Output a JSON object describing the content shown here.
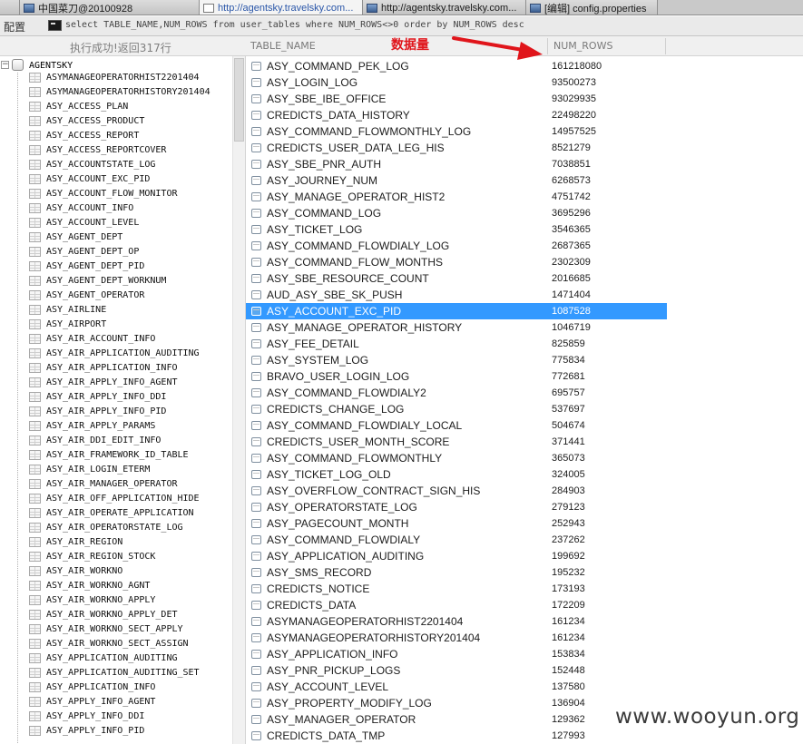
{
  "tabs": [
    {
      "title": "中国菜刀@20100928",
      "icon": "app-icon",
      "active": false
    },
    {
      "title": "http://agentsky.travelsky.com...",
      "icon": "page-icon",
      "active": true
    },
    {
      "title": "http://agentsky.travelsky.com...",
      "icon": "app-icon",
      "active": false
    },
    {
      "title": "[编辑] config.properties",
      "icon": "app-icon",
      "active": false
    }
  ],
  "toolbar": {
    "config_label": "配置",
    "sql": "select TABLE_NAME,NUM_ROWS from user_tables where NUM_ROWS<>0 order by NUM_ROWS desc"
  },
  "status": "执行成功!返回317行",
  "columns": {
    "table_name": "TABLE_NAME",
    "num_rows": "NUM_ROWS"
  },
  "annotation": {
    "label": "数据量",
    "color": "#e0151b"
  },
  "tree": {
    "root": "AGENTSKY",
    "items": [
      "ASYMANAGEOPERATORHIST2201404",
      "ASYMANAGEOPERATORHISTORY201404",
      "ASY_ACCESS_PLAN",
      "ASY_ACCESS_PRODUCT",
      "ASY_ACCESS_REPORT",
      "ASY_ACCESS_REPORTCOVER",
      "ASY_ACCOUNTSTATE_LOG",
      "ASY_ACCOUNT_EXC_PID",
      "ASY_ACCOUNT_FLOW_MONITOR",
      "ASY_ACCOUNT_INFO",
      "ASY_ACCOUNT_LEVEL",
      "ASY_AGENT_DEPT",
      "ASY_AGENT_DEPT_OP",
      "ASY_AGENT_DEPT_PID",
      "ASY_AGENT_DEPT_WORKNUM",
      "ASY_AGENT_OPERATOR",
      "ASY_AIRLINE",
      "ASY_AIRPORT",
      "ASY_AIR_ACCOUNT_INFO",
      "ASY_AIR_APPLICATION_AUDITING",
      "ASY_AIR_APPLICATION_INFO",
      "ASY_AIR_APPLY_INFO_AGENT",
      "ASY_AIR_APPLY_INFO_DDI",
      "ASY_AIR_APPLY_INFO_PID",
      "ASY_AIR_APPLY_PARAMS",
      "ASY_AIR_DDI_EDIT_INFO",
      "ASY_AIR_FRAMEWORK_ID_TABLE",
      "ASY_AIR_LOGIN_ETERM",
      "ASY_AIR_MANAGER_OPERATOR",
      "ASY_AIR_OFF_APPLICATION_HIDE",
      "ASY_AIR_OPERATE_APPLICATION",
      "ASY_AIR_OPERATORSTATE_LOG",
      "ASY_AIR_REGION",
      "ASY_AIR_REGION_STOCK",
      "ASY_AIR_WORKNO",
      "ASY_AIR_WORKNO_AGNT",
      "ASY_AIR_WORKNO_APPLY",
      "ASY_AIR_WORKNO_APPLY_DET",
      "ASY_AIR_WORKNO_SECT_APPLY",
      "ASY_AIR_WORKNO_SECT_ASSIGN",
      "ASY_APPLICATION_AUDITING",
      "ASY_APPLICATION_AUDITING_SET",
      "ASY_APPLICATION_INFO",
      "ASY_APPLY_INFO_AGENT",
      "ASY_APPLY_INFO_DDI",
      "ASY_APPLY_INFO_PID"
    ]
  },
  "rows": [
    {
      "name": "ASY_COMMAND_PEK_LOG",
      "rows": "161218080"
    },
    {
      "name": "ASY_LOGIN_LOG",
      "rows": "93500273"
    },
    {
      "name": "ASY_SBE_IBE_OFFICE",
      "rows": "93029935"
    },
    {
      "name": "CREDICTS_DATA_HISTORY",
      "rows": "22498220"
    },
    {
      "name": "ASY_COMMAND_FLOWMONTHLY_LOG",
      "rows": "14957525"
    },
    {
      "name": "CREDICTS_USER_DATA_LEG_HIS",
      "rows": "8521279"
    },
    {
      "name": "ASY_SBE_PNR_AUTH",
      "rows": "7038851"
    },
    {
      "name": "ASY_JOURNEY_NUM",
      "rows": "6268573"
    },
    {
      "name": "ASY_MANAGE_OPERATOR_HIST2",
      "rows": "4751742"
    },
    {
      "name": "ASY_COMMAND_LOG",
      "rows": "3695296"
    },
    {
      "name": "ASY_TICKET_LOG",
      "rows": "3546365"
    },
    {
      "name": "ASY_COMMAND_FLOWDIALY_LOG",
      "rows": "2687365"
    },
    {
      "name": "ASY_COMMAND_FLOW_MONTHS",
      "rows": "2302309"
    },
    {
      "name": "ASY_SBE_RESOURCE_COUNT",
      "rows": "2016685"
    },
    {
      "name": "AUD_ASY_SBE_SK_PUSH",
      "rows": "1471404"
    },
    {
      "name": "ASY_ACCOUNT_EXC_PID",
      "rows": "1087528",
      "selected": true
    },
    {
      "name": "ASY_MANAGE_OPERATOR_HISTORY",
      "rows": "1046719"
    },
    {
      "name": "ASY_FEE_DETAIL",
      "rows": "825859"
    },
    {
      "name": "ASY_SYSTEM_LOG",
      "rows": "775834"
    },
    {
      "name": "BRAVO_USER_LOGIN_LOG",
      "rows": "772681"
    },
    {
      "name": "ASY_COMMAND_FLOWDIALY2",
      "rows": "695757"
    },
    {
      "name": "CREDICTS_CHANGE_LOG",
      "rows": "537697"
    },
    {
      "name": "ASY_COMMAND_FLOWDIALY_LOCAL",
      "rows": "504674"
    },
    {
      "name": "CREDICTS_USER_MONTH_SCORE",
      "rows": "371441"
    },
    {
      "name": "ASY_COMMAND_FLOWMONTHLY",
      "rows": "365073"
    },
    {
      "name": "ASY_TICKET_LOG_OLD",
      "rows": "324005"
    },
    {
      "name": "ASY_OVERFLOW_CONTRACT_SIGN_HIS",
      "rows": "284903"
    },
    {
      "name": "ASY_OPERATORSTATE_LOG",
      "rows": "279123"
    },
    {
      "name": "ASY_PAGECOUNT_MONTH",
      "rows": "252943"
    },
    {
      "name": "ASY_COMMAND_FLOWDIALY",
      "rows": "237262"
    },
    {
      "name": "ASY_APPLICATION_AUDITING",
      "rows": "199692"
    },
    {
      "name": "ASY_SMS_RECORD",
      "rows": "195232"
    },
    {
      "name": "CREDICTS_NOTICE",
      "rows": "173193"
    },
    {
      "name": "CREDICTS_DATA",
      "rows": "172209"
    },
    {
      "name": "ASYMANAGEOPERATORHIST2201404",
      "rows": "161234"
    },
    {
      "name": "ASYMANAGEOPERATORHISTORY201404",
      "rows": "161234"
    },
    {
      "name": "ASY_APPLICATION_INFO",
      "rows": "153834"
    },
    {
      "name": "ASY_PNR_PICKUP_LOGS",
      "rows": "152448"
    },
    {
      "name": "ASY_ACCOUNT_LEVEL",
      "rows": "137580"
    },
    {
      "name": "ASY_PROPERTY_MODIFY_LOG",
      "rows": "136904"
    },
    {
      "name": "ASY_MANAGER_OPERATOR",
      "rows": "129362"
    },
    {
      "name": "CREDICTS_DATA_TMP",
      "rows": "127993"
    }
  ],
  "colors": {
    "selection": "#3399ff",
    "annotation": "#e0151b"
  },
  "watermark": "www.wooyun.org"
}
